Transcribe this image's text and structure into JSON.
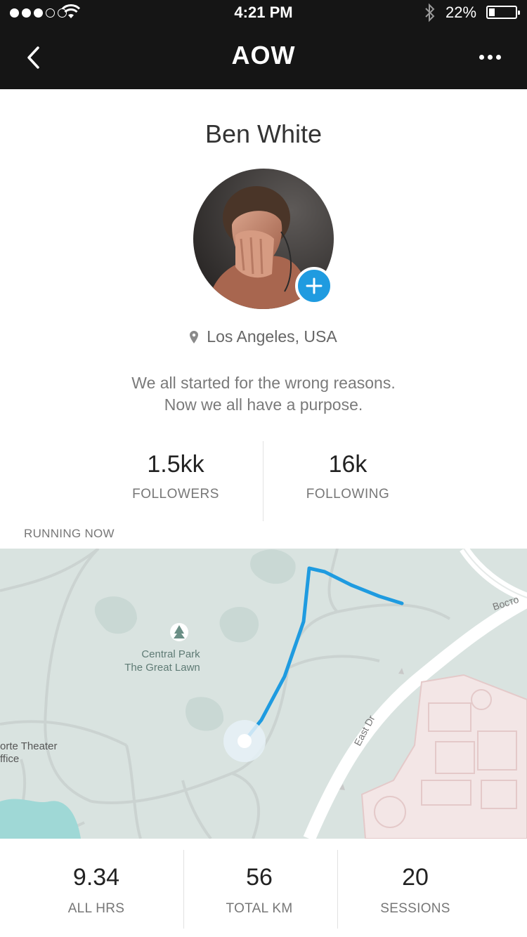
{
  "status_bar": {
    "time": "4:21 PM",
    "battery_percent": "22%",
    "battery_level": 0.22,
    "signal_bars": 3,
    "signal_max": 5,
    "icons": [
      "signal-icon",
      "wifi-icon",
      "bluetooth-icon",
      "battery-icon"
    ]
  },
  "nav": {
    "title": "AOW",
    "back_icon": "chevron-left-icon",
    "more_icon": "more-horizontal-icon"
  },
  "profile": {
    "name": "Ben White",
    "location": "Los Angeles, USA",
    "location_icon": "map-pin-icon",
    "bio_line1": "We all started for the wrong reasons.",
    "bio_line2": "Now we all have a purpose.",
    "add_icon": "plus-icon"
  },
  "social": {
    "followers_value": "1.5kk",
    "followers_label": "FOLLOWERS",
    "following_value": "16k",
    "following_label": "FOLLOWING"
  },
  "running": {
    "label": "RUNNING NOW",
    "map": {
      "poi_line1": "Central Park",
      "poi_line2": "The Great Lawn",
      "left_label_line1": "orte Theater",
      "left_label_line2": "ffice",
      "road_east": "East Dr",
      "road_top": "Восто",
      "poi_icon": "tree-icon",
      "route_color": "#1f9be0"
    }
  },
  "summary": {
    "hrs_value": "9.34",
    "hrs_label": "ALL HRS",
    "km_value": "56",
    "km_label": "TOTAL KM",
    "sessions_value": "20",
    "sessions_label": "SESSIONS"
  }
}
